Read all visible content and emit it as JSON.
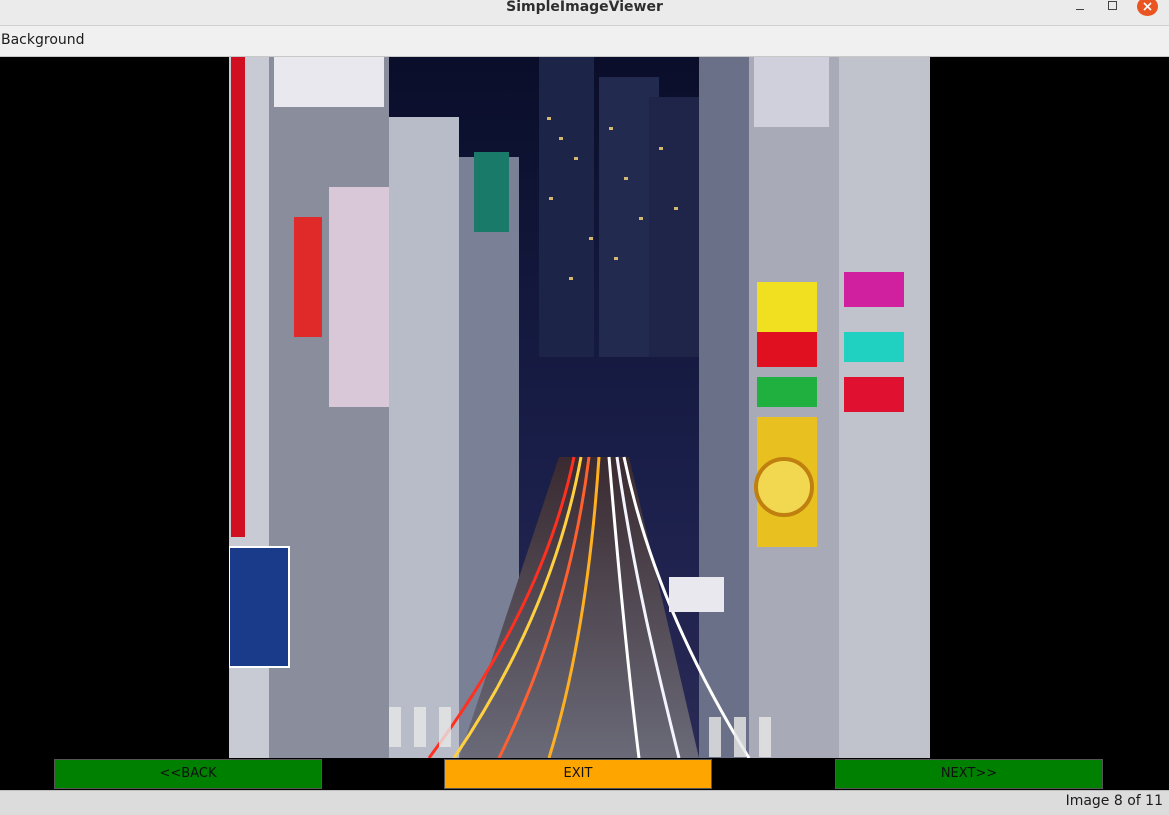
{
  "window": {
    "title": "SimpleImageViewer",
    "controls": [
      "minimize-icon",
      "maximize-icon",
      "close-icon"
    ],
    "close_color": "#e95420"
  },
  "menubar": {
    "items": [
      {
        "label": "Background"
      }
    ]
  },
  "viewer": {
    "image_description_icon": "city-night-photo",
    "background_color": "#000000"
  },
  "buttons": {
    "back_label": "<<BACK",
    "exit_label": "EXIT",
    "next_label": "NEXT>>",
    "back_color": "#008000",
    "exit_color": "#ffa500",
    "next_color": "#008000"
  },
  "status": {
    "text": "Image 8 of 11"
  }
}
